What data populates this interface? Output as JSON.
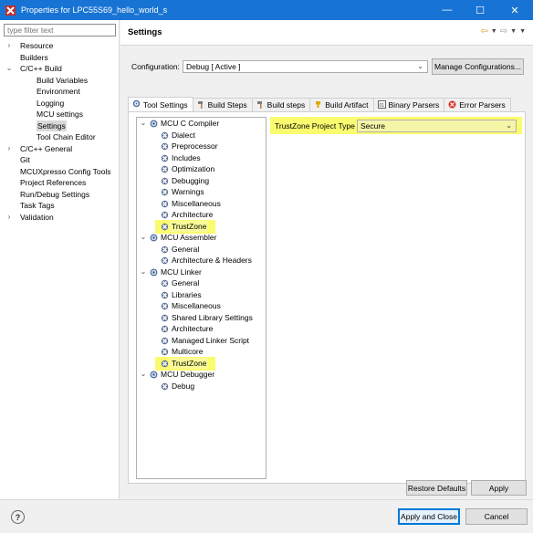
{
  "window": {
    "title": "Properties for LPC55S69_hello_world_s",
    "minimize": "—",
    "maximize": "☐",
    "close": "✕"
  },
  "filter": {
    "placeholder": "type filter text"
  },
  "left_tree": [
    {
      "label": "Resource",
      "indent": 0,
      "twisty": "›"
    },
    {
      "label": "Builders",
      "indent": 0,
      "twisty": ""
    },
    {
      "label": "C/C++ Build",
      "indent": 0,
      "twisty": "⌄"
    },
    {
      "label": "Build Variables",
      "indent": 1,
      "twisty": ""
    },
    {
      "label": "Environment",
      "indent": 1,
      "twisty": ""
    },
    {
      "label": "Logging",
      "indent": 1,
      "twisty": ""
    },
    {
      "label": "MCU settings",
      "indent": 1,
      "twisty": ""
    },
    {
      "label": "Settings",
      "indent": 1,
      "twisty": "",
      "selected": true
    },
    {
      "label": "Tool Chain Editor",
      "indent": 1,
      "twisty": ""
    },
    {
      "label": "C/C++ General",
      "indent": 0,
      "twisty": "›"
    },
    {
      "label": "Git",
      "indent": 0,
      "twisty": ""
    },
    {
      "label": "MCUXpresso Config Tools",
      "indent": 0,
      "twisty": ""
    },
    {
      "label": "Project References",
      "indent": 0,
      "twisty": ""
    },
    {
      "label": "Run/Debug Settings",
      "indent": 0,
      "twisty": ""
    },
    {
      "label": "Task Tags",
      "indent": 0,
      "twisty": ""
    },
    {
      "label": "Validation",
      "indent": 0,
      "twisty": "›"
    }
  ],
  "header": {
    "title": "Settings"
  },
  "config": {
    "label": "Configuration:",
    "value": "Debug  [ Active ]",
    "manage_label": "Manage Configurations..."
  },
  "tabs": [
    {
      "label": "Tool Settings",
      "icon": "gear",
      "active": true
    },
    {
      "label": "Build Steps",
      "icon": "hammer"
    },
    {
      "label": "Build steps",
      "icon": "hammer"
    },
    {
      "label": "Build Artifact",
      "icon": "trophy"
    },
    {
      "label": "Binary Parsers",
      "icon": "binary"
    },
    {
      "label": "Error Parsers",
      "icon": "error"
    }
  ],
  "tool_tree": [
    {
      "label": "MCU C Compiler",
      "level": 0,
      "twisty": "⌄"
    },
    {
      "label": "Dialect",
      "level": 1
    },
    {
      "label": "Preprocessor",
      "level": 1
    },
    {
      "label": "Includes",
      "level": 1
    },
    {
      "label": "Optimization",
      "level": 1
    },
    {
      "label": "Debugging",
      "level": 1
    },
    {
      "label": "Warnings",
      "level": 1
    },
    {
      "label": "Miscellaneous",
      "level": 1
    },
    {
      "label": "Architecture",
      "level": 1
    },
    {
      "label": "TrustZone",
      "level": 1,
      "highlight": true
    },
    {
      "label": "MCU Assembler",
      "level": 0,
      "twisty": "⌄"
    },
    {
      "label": "General",
      "level": 1
    },
    {
      "label": "Architecture & Headers",
      "level": 1
    },
    {
      "label": "MCU Linker",
      "level": 0,
      "twisty": "⌄"
    },
    {
      "label": "General",
      "level": 1
    },
    {
      "label": "Libraries",
      "level": 1
    },
    {
      "label": "Miscellaneous",
      "level": 1
    },
    {
      "label": "Shared Library Settings",
      "level": 1
    },
    {
      "label": "Architecture",
      "level": 1
    },
    {
      "label": "Managed Linker Script",
      "level": 1
    },
    {
      "label": "Multicore",
      "level": 1
    },
    {
      "label": "TrustZone",
      "level": 1,
      "highlight": true
    },
    {
      "label": "MCU Debugger",
      "level": 0,
      "twisty": "⌄"
    },
    {
      "label": "Debug",
      "level": 1
    }
  ],
  "trustzone": {
    "label": "TrustZone Project Type",
    "value": "Secure"
  },
  "buttons": {
    "restore": "Restore Defaults",
    "apply": "Apply",
    "apply_close": "Apply and Close",
    "cancel": "Cancel",
    "help": "?"
  },
  "colors": {
    "titlebar": "#1874d4",
    "highlight": "#fbfb6f",
    "accent": "#0078d7"
  }
}
